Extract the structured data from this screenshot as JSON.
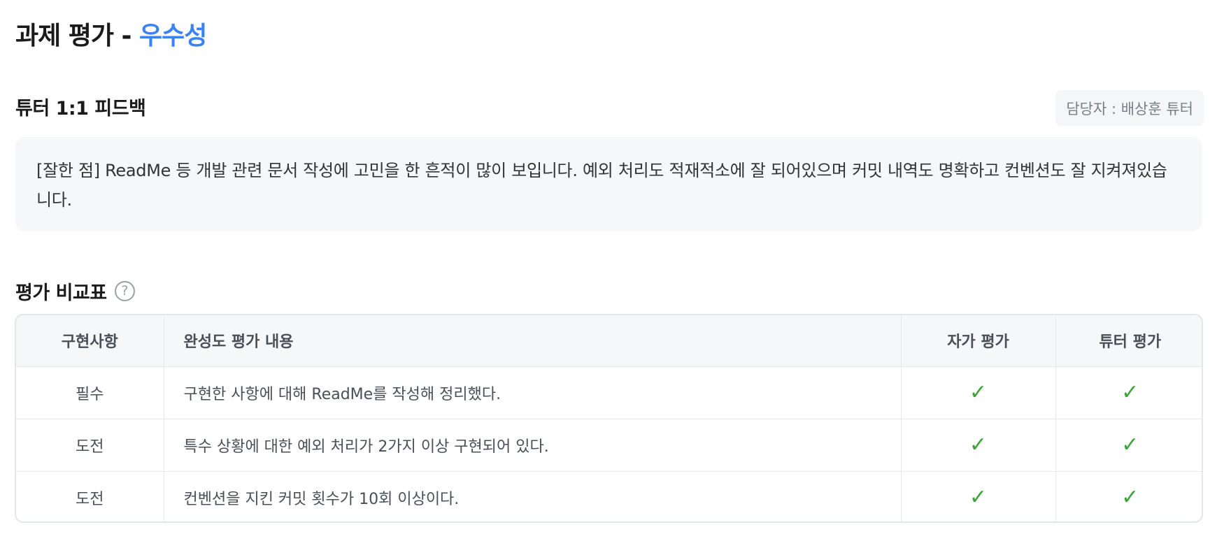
{
  "header": {
    "title_prefix": "과제 평가 - ",
    "title_grade": "우수성",
    "accent_color": "#3b82f6"
  },
  "feedback": {
    "title": "튜터 1:1 피드백",
    "tutor_label": "담당자 : 배상훈 튜터",
    "text": "[잘한 점] ReadMe 등 개발 관련 문서 작성에 고민을 한 흔적이 많이 보입니다. 예외 처리도 적재적소에 잘 되어있으며 커밋 내역도 명확하고 컨벤션도 잘 지켜져있습니다."
  },
  "comparison": {
    "title": "평가 비교표",
    "help_icon": "?",
    "columns": [
      "구현사항",
      "완성도 평가 내용",
      "자가 평가",
      "튜터 평가"
    ],
    "rows": [
      {
        "type": "필수",
        "content": "구현한 사항에 대해 ReadMe를 작성해 정리했다.",
        "self": "✓",
        "tutor": "✓"
      },
      {
        "type": "도전",
        "content": "특수 상황에 대한 예외 처리가 2가지 이상 구현되어 있다.",
        "self": "✓",
        "tutor": "✓"
      },
      {
        "type": "도전",
        "content": "컨벤션을 지킨 커밋 횟수가 10회 이상이다.",
        "self": "✓",
        "tutor": "✓"
      }
    ],
    "check_color": "#3fa33a"
  }
}
